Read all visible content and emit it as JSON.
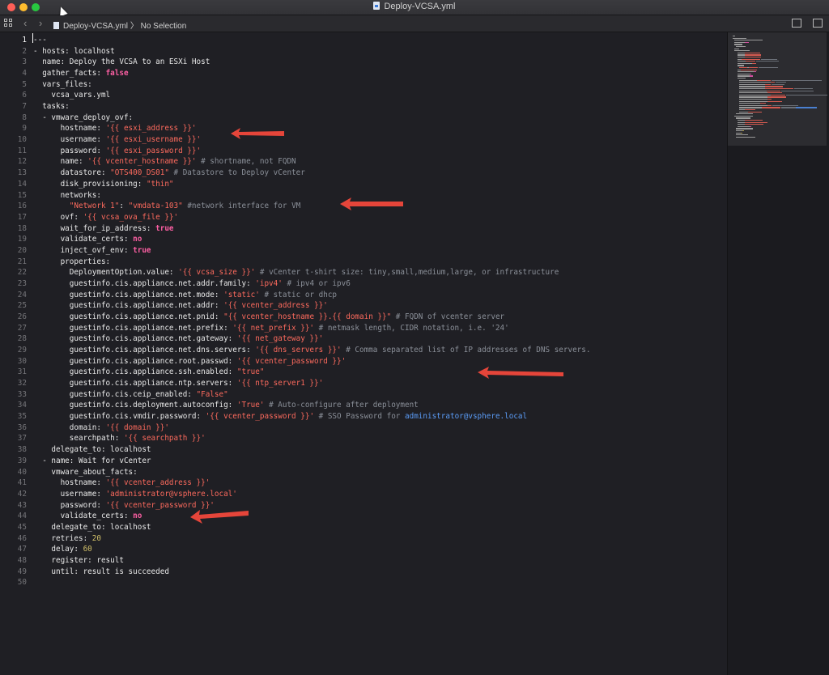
{
  "window": {
    "title": "Deploy-VCSA.yml"
  },
  "toolbar": {
    "file": "Deploy-VCSA.yml",
    "separator": "〉",
    "selection": "No Selection",
    "back": "‹",
    "forward": "›"
  },
  "colors": {
    "string": "#fc6a5d",
    "bool": "#fc5fa3",
    "number": "#d0bf69",
    "comment": "#8b9099",
    "link": "#5b9cf7",
    "arrow": "#e5453a"
  },
  "editor": {
    "active_line": 1,
    "lines": [
      {
        "n": "1",
        "t": [
          [
            "k",
            "---"
          ]
        ]
      },
      {
        "n": "2",
        "t": [
          [
            "k",
            "- hosts: localhost"
          ]
        ]
      },
      {
        "n": "3",
        "t": [
          [
            "k",
            "  name: Deploy the VCSA to an ESXi Host"
          ]
        ]
      },
      {
        "n": "4",
        "t": [
          [
            "k",
            "  gather_facts: "
          ],
          [
            "b",
            "false"
          ]
        ]
      },
      {
        "n": "5",
        "t": [
          [
            "k",
            "  vars_files:"
          ]
        ]
      },
      {
        "n": "6",
        "t": [
          [
            "k",
            "    vcsa_vars.yml"
          ]
        ]
      },
      {
        "n": "7",
        "t": [
          [
            "k",
            "  tasks:"
          ]
        ]
      },
      {
        "n": "8",
        "t": [
          [
            "k",
            "  - vmware_deploy_ovf:"
          ]
        ]
      },
      {
        "n": "9",
        "t": [
          [
            "k",
            "      hostname: "
          ],
          [
            "s",
            "'{{ esxi_address }}'"
          ]
        ]
      },
      {
        "n": "10",
        "t": [
          [
            "k",
            "      username: "
          ],
          [
            "s",
            "'{{ esxi_username }}'"
          ]
        ]
      },
      {
        "n": "11",
        "t": [
          [
            "k",
            "      password: "
          ],
          [
            "s",
            "'{{ esxi_password }}'"
          ]
        ]
      },
      {
        "n": "12",
        "t": [
          [
            "k",
            "      name: "
          ],
          [
            "s",
            "'{{ vcenter_hostname }}'"
          ],
          [
            "c",
            " # shortname, not FQDN"
          ]
        ]
      },
      {
        "n": "13",
        "t": [
          [
            "k",
            "      datastore: "
          ],
          [
            "s",
            "\"OTS400_DS01\""
          ],
          [
            "c",
            " # Datastore to Deploy vCenter"
          ]
        ]
      },
      {
        "n": "14",
        "t": [
          [
            "k",
            "      disk_provisioning: "
          ],
          [
            "s",
            "\"thin\""
          ]
        ]
      },
      {
        "n": "15",
        "t": [
          [
            "k",
            "      networks:"
          ]
        ]
      },
      {
        "n": "16",
        "t": [
          [
            "s",
            "        \"Network 1\""
          ],
          [
            "k",
            ": "
          ],
          [
            "s",
            "\"vmdata-103\""
          ],
          [
            "c",
            " #network interface for VM"
          ]
        ]
      },
      {
        "n": "17",
        "t": [
          [
            "k",
            "      ovf: "
          ],
          [
            "s",
            "'{{ vcsa_ova_file }}'"
          ]
        ]
      },
      {
        "n": "18",
        "t": [
          [
            "k",
            "      wait_for_ip_address: "
          ],
          [
            "b",
            "true"
          ]
        ]
      },
      {
        "n": "19",
        "t": [
          [
            "k",
            "      validate_certs: "
          ],
          [
            "b",
            "no"
          ]
        ]
      },
      {
        "n": "20",
        "t": [
          [
            "k",
            "      inject_ovf_env: "
          ],
          [
            "b",
            "true"
          ]
        ]
      },
      {
        "n": "21",
        "t": [
          [
            "k",
            "      properties:"
          ]
        ]
      },
      {
        "n": "22",
        "t": [
          [
            "k",
            "        DeploymentOption.value: "
          ],
          [
            "s",
            "'{{ vcsa_size }}'"
          ],
          [
            "c",
            " # vCenter t-shirt size: tiny,small,medium,large, or infrastructure"
          ]
        ]
      },
      {
        "n": "23",
        "t": [
          [
            "k",
            "        guestinfo.cis.appliance.net.addr.family: "
          ],
          [
            "s",
            "'ipv4'"
          ],
          [
            "c",
            " # ipv4 or ipv6"
          ]
        ]
      },
      {
        "n": "24",
        "t": [
          [
            "k",
            "        guestinfo.cis.appliance.net.mode: "
          ],
          [
            "s",
            "'static'"
          ],
          [
            "c",
            " # static or dhcp"
          ]
        ]
      },
      {
        "n": "25",
        "t": [
          [
            "k",
            "        guestinfo.cis.appliance.net.addr: "
          ],
          [
            "s",
            "'{{ vcenter_address }}'"
          ]
        ]
      },
      {
        "n": "26",
        "t": [
          [
            "k",
            "        guestinfo.cis.appliance.net.pnid: "
          ],
          [
            "s",
            "\"{{ vcenter_hostname }}.{{ domain }}\""
          ],
          [
            "c",
            " # FQDN of vcenter server"
          ]
        ]
      },
      {
        "n": "27",
        "t": [
          [
            "k",
            "        guestinfo.cis.appliance.net.prefix: "
          ],
          [
            "s",
            "'{{ net_prefix }}'"
          ],
          [
            "c",
            " # netmask length, CIDR notation, i.e. '24'"
          ]
        ]
      },
      {
        "n": "28",
        "t": [
          [
            "k",
            "        guestinfo.cis.appliance.net.gateway: "
          ],
          [
            "s",
            "'{{ net_gateway }}'"
          ]
        ]
      },
      {
        "n": "29",
        "t": [
          [
            "k",
            "        guestinfo.cis.appliance.net.dns.servers: "
          ],
          [
            "s",
            "'{{ dns_servers }}'"
          ],
          [
            "c",
            " # Comma separated list of IP addresses of DNS servers."
          ]
        ]
      },
      {
        "n": "30",
        "t": [
          [
            "k",
            "        guestinfo.cis.appliance.root.passwd: "
          ],
          [
            "s",
            "'{{ vcenter_password }}'"
          ]
        ]
      },
      {
        "n": "31",
        "t": [
          [
            "k",
            "        guestinfo.cis.appliance.ssh.enabled: "
          ],
          [
            "s",
            "\"true\""
          ]
        ]
      },
      {
        "n": "32",
        "t": [
          [
            "k",
            "        guestinfo.cis.appliance.ntp.servers: "
          ],
          [
            "s",
            "'{{ ntp_server1 }}'"
          ]
        ]
      },
      {
        "n": "33",
        "t": [
          [
            "k",
            "        guestinfo.cis.ceip_enabled: "
          ],
          [
            "s",
            "\"False\""
          ]
        ]
      },
      {
        "n": "34",
        "t": [
          [
            "k",
            "        guestinfo.cis.deployment.autoconfig: "
          ],
          [
            "s",
            "'True'"
          ],
          [
            "c",
            " # Auto-configure after deployment"
          ]
        ]
      },
      {
        "n": "35",
        "t": [
          [
            "k",
            "        guestinfo.cis.vmdir.password: "
          ],
          [
            "s",
            "'{{ vcenter_password }}'"
          ],
          [
            "c",
            " # SSO Password for "
          ],
          [
            "l",
            "administrator@vsphere.local"
          ]
        ]
      },
      {
        "n": "36",
        "t": [
          [
            "k",
            "        domain: "
          ],
          [
            "s",
            "'{{ domain }}'"
          ]
        ]
      },
      {
        "n": "37",
        "t": [
          [
            "k",
            "        searchpath: "
          ],
          [
            "s",
            "'{{ searchpath }}'"
          ]
        ]
      },
      {
        "n": "38",
        "t": [
          [
            "k",
            "    delegate_to: localhost"
          ]
        ]
      },
      {
        "n": "39",
        "t": [
          [
            "k",
            "  - name: Wait for vCenter"
          ]
        ]
      },
      {
        "n": "40",
        "t": [
          [
            "k",
            "    vmware_about_facts:"
          ]
        ]
      },
      {
        "n": "41",
        "t": [
          [
            "k",
            "      hostname: "
          ],
          [
            "s",
            "'{{ vcenter_address }}'"
          ]
        ]
      },
      {
        "n": "42",
        "t": [
          [
            "k",
            "      username: "
          ],
          [
            "s",
            "'administrator@vsphere.local'"
          ]
        ]
      },
      {
        "n": "43",
        "t": [
          [
            "k",
            "      password: "
          ],
          [
            "s",
            "'{{ vcenter_password }}'"
          ]
        ]
      },
      {
        "n": "44",
        "t": [
          [
            "k",
            "      validate_certs: "
          ],
          [
            "b",
            "no"
          ]
        ]
      },
      {
        "n": "45",
        "t": [
          [
            "k",
            "    delegate_to: localhost"
          ]
        ]
      },
      {
        "n": "46",
        "t": [
          [
            "k",
            "    retries: "
          ],
          [
            "n",
            "20"
          ]
        ]
      },
      {
        "n": "47",
        "t": [
          [
            "k",
            "    delay: "
          ],
          [
            "n",
            "60"
          ]
        ]
      },
      {
        "n": "48",
        "t": [
          [
            "k",
            "    register: result"
          ]
        ]
      },
      {
        "n": "49",
        "t": [
          [
            "k",
            "    until: result is succeeded"
          ]
        ]
      },
      {
        "n": "50",
        "t": []
      }
    ]
  }
}
